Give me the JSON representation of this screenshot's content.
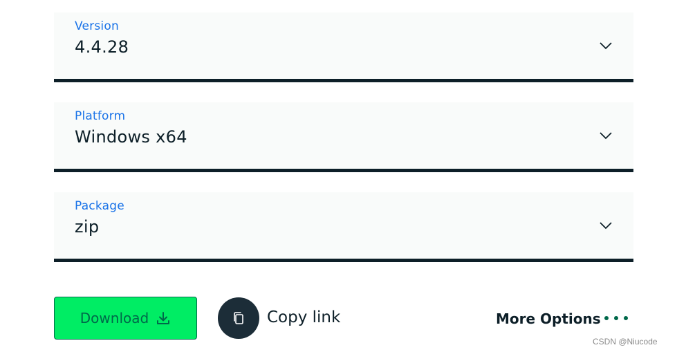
{
  "version_select": {
    "label": "Version",
    "value": "4.4.28",
    "icon": "chevron-down-icon"
  },
  "platform_select": {
    "label": "Platform",
    "value": "Windows x64",
    "icon": "chevron-down-icon"
  },
  "package_select": {
    "label": "Package",
    "value": "zip",
    "icon": "chevron-down-icon"
  },
  "actions": {
    "download_label": "Download",
    "download_icon": "download-icon",
    "copy_link_label": "Copy link",
    "copy_icon": "copy-icon",
    "more_options_label": "More Options",
    "more_icon": "ellipsis-icon"
  },
  "watermark": "CSDN @Niucode",
  "colors": {
    "label_blue": "#1a73e8",
    "text_dark": "#0d1f28",
    "download_green": "#00ed64",
    "download_text": "#00684a",
    "copy_circle": "#1c2d38",
    "dots_green": "#00684a",
    "field_bg": "#f9fbfa"
  }
}
